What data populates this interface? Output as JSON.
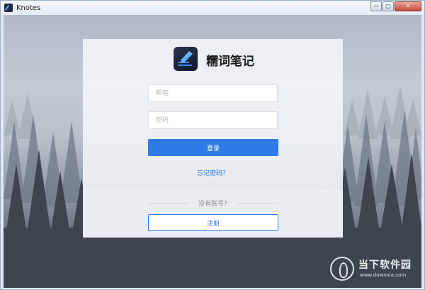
{
  "window": {
    "title": "Knotes",
    "controls": {
      "minimize": "—",
      "maximize": "□",
      "close": "✕"
    }
  },
  "app": {
    "name": "糯词笔记",
    "logo_icon": "pen-notebook-icon"
  },
  "form": {
    "email_placeholder": "邮箱",
    "password_placeholder": "密码",
    "login_label": "登录",
    "forgot_label": "忘记密码？"
  },
  "footer": {
    "no_account_text": "没有账号?",
    "register_label": "注册"
  },
  "watermark": {
    "title": "当下软件园",
    "url": "www.downxia.com"
  },
  "colors": {
    "accent": "#2d7be8",
    "title_bar": "#e3ebf3",
    "logo_bg": "#1a2138"
  }
}
